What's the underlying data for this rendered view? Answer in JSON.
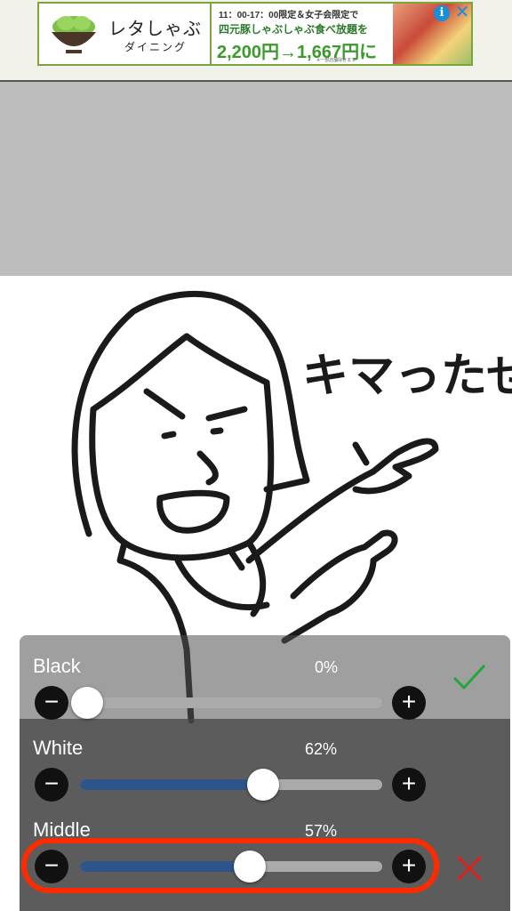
{
  "ad": {
    "brand": "レタしゃぶ",
    "brand_sub": "ダイニング",
    "time_text": "11：00-17：00限定＆女子会限定で",
    "offer_text": "四元豚しゃぶしゃぶ食べ放題",
    "offer_suffix": "を",
    "price_text": "2,200円→1,667円に",
    "fine_print": "※一部店舗除きます",
    "info_icon": "i",
    "close_icon": "✕"
  },
  "sticker": {
    "caption": "キマったぜ"
  },
  "controls": {
    "black": {
      "label": "Black",
      "percent": "0%",
      "level": 0.0
    },
    "white": {
      "label": "White",
      "percent": "62%",
      "level": 0.62
    },
    "middle": {
      "label": "Middle",
      "percent": "57%",
      "level": 0.57
    },
    "minus_glyph": "−",
    "plus_glyph": "+"
  },
  "colors": {
    "accent_fill": "#2d5588",
    "confirm": "#22a83a",
    "cancel": "#e0201a",
    "highlight": "#ff2a00"
  }
}
